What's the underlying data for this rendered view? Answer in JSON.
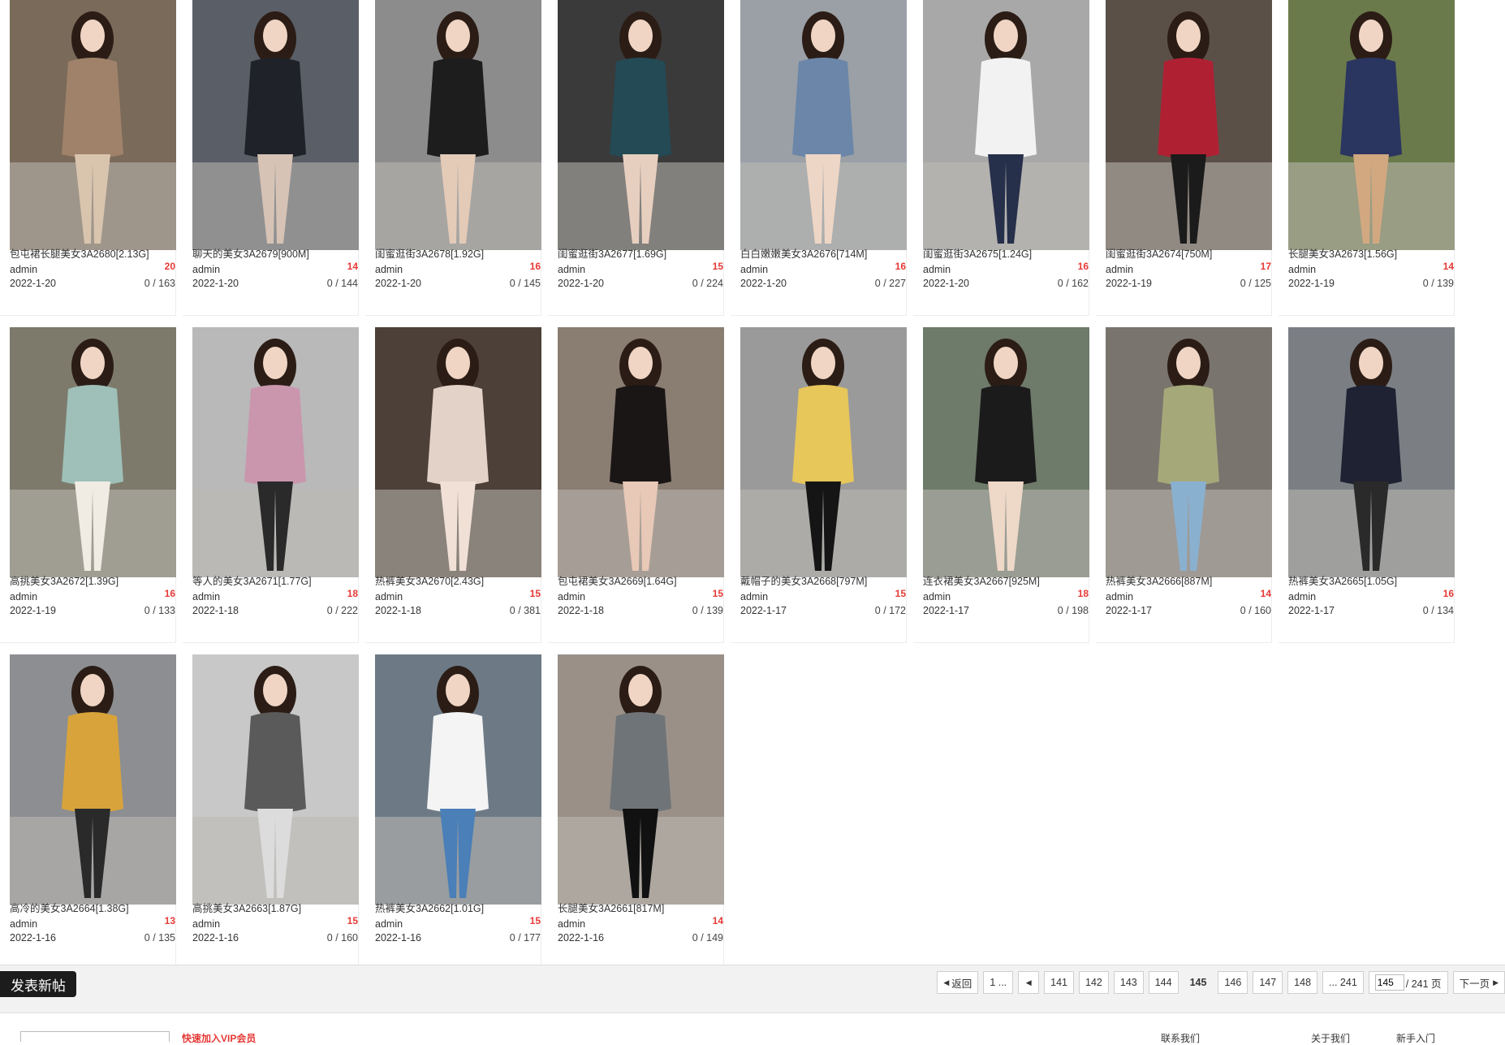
{
  "posts": [
    {
      "title": "包屯裙长腿美女3A2680[2.13G]",
      "author": "admin",
      "date": "2022-1-20",
      "count": "20",
      "stats": "0 / 163",
      "colors": [
        "#7a6a5a",
        "#a0826a",
        "#d9c4ae"
      ]
    },
    {
      "title": "聊天的美女3A2679[900M]",
      "author": "admin",
      "date": "2022-1-20",
      "count": "14",
      "stats": "0 / 144",
      "colors": [
        "#5a5e66",
        "#1f2228",
        "#d6c3b5"
      ]
    },
    {
      "title": "闺蜜逛街3A2678[1.92G]",
      "author": "admin",
      "date": "2022-1-20",
      "count": "16",
      "stats": "0 / 145",
      "colors": [
        "#8c8c8c",
        "#1d1d1d",
        "#e3cbb8"
      ]
    },
    {
      "title": "闺蜜逛街3A2677[1.69G]",
      "author": "admin",
      "date": "2022-1-20",
      "count": "15",
      "stats": "0 / 224",
      "colors": [
        "#3a3a3a",
        "#234a55",
        "#e7cfbf"
      ]
    },
    {
      "title": "白白嫩嫩美女3A2676[714M]",
      "author": "admin",
      "date": "2022-1-20",
      "count": "16",
      "stats": "0 / 227",
      "colors": [
        "#9aa0a6",
        "#6b86a8",
        "#eed6c6"
      ]
    },
    {
      "title": "闺蜜逛街3A2675[1.24G]",
      "author": "admin",
      "date": "2022-1-20",
      "count": "16",
      "stats": "0 / 162",
      "colors": [
        "#a8a8a8",
        "#f2f2f2",
        "#26304a"
      ]
    },
    {
      "title": "闺蜜逛街3A2674[750M]",
      "author": "admin",
      "date": "2022-1-19",
      "count": "17",
      "stats": "0 / 125",
      "colors": [
        "#5b5048",
        "#b02033",
        "#1b1b1b"
      ]
    },
    {
      "title": "长腿美女3A2673[1.56G]",
      "author": "admin",
      "date": "2022-1-19",
      "count": "14",
      "stats": "0 / 139",
      "colors": [
        "#6b7a4a",
        "#2a3560",
        "#d2a880"
      ]
    },
    {
      "title": "高挑美女3A2672[1.39G]",
      "author": "admin",
      "date": "2022-1-19",
      "count": "16",
      "stats": "0 / 133",
      "colors": [
        "#7d7a6c",
        "#9ec0b8",
        "#f0ece4"
      ]
    },
    {
      "title": "等人的美女3A2671[1.77G]",
      "author": "admin",
      "date": "2022-1-18",
      "count": "18",
      "stats": "0 / 222",
      "colors": [
        "#b9b9b9",
        "#c996ad",
        "#2a2a2a"
      ]
    },
    {
      "title": "热裤美女3A2670[2.43G]",
      "author": "admin",
      "date": "2022-1-18",
      "count": "15",
      "stats": "0 / 381",
      "colors": [
        "#4d4038",
        "#e2d2c8",
        "#f1e0d6"
      ]
    },
    {
      "title": "包屯裙美女3A2669[1.64G]",
      "author": "admin",
      "date": "2022-1-18",
      "count": "15",
      "stats": "0 / 139",
      "colors": [
        "#8a7d72",
        "#1a1616",
        "#e8c8b6"
      ]
    },
    {
      "title": "戴帽子的美女3A2668[797M]",
      "author": "admin",
      "date": "2022-1-17",
      "count": "15",
      "stats": "0 / 172",
      "colors": [
        "#9a9a9a",
        "#e7c65a",
        "#151515"
      ]
    },
    {
      "title": "连衣裙美女3A2667[925M]",
      "author": "admin",
      "date": "2022-1-17",
      "count": "18",
      "stats": "0 / 198",
      "colors": [
        "#6e7a6a",
        "#1b1b1b",
        "#eed8c8"
      ]
    },
    {
      "title": "热裤美女3A2666[887M]",
      "author": "admin",
      "date": "2022-1-17",
      "count": "14",
      "stats": "0 / 160",
      "colors": [
        "#7a746e",
        "#a5a97a",
        "#8ab0cf"
      ]
    },
    {
      "title": "热裤美女3A2665[1.05G]",
      "author": "admin",
      "date": "2022-1-17",
      "count": "16",
      "stats": "0 / 134",
      "colors": [
        "#7b7f84",
        "#1f2233",
        "#2a2a2a"
      ]
    },
    {
      "title": "高冷的美女3A2664[1.38G]",
      "author": "admin",
      "date": "2022-1-16",
      "count": "13",
      "stats": "0 / 135",
      "colors": [
        "#8c8e92",
        "#d8a33a",
        "#2a2a2a"
      ]
    },
    {
      "title": "高挑美女3A2663[1.87G]",
      "author": "admin",
      "date": "2022-1-16",
      "count": "15",
      "stats": "0 / 160",
      "colors": [
        "#c8c8c8",
        "#5a5a5a",
        "#dcdcdc"
      ]
    },
    {
      "title": "热裤美女3A2662[1.01G]",
      "author": "admin",
      "date": "2022-1-16",
      "count": "15",
      "stats": "0 / 177",
      "colors": [
        "#6d7a86",
        "#f4f4f4",
        "#4a7fb8"
      ]
    },
    {
      "title": "长腿美女3A2661[817M]",
      "author": "admin",
      "date": "2022-1-16",
      "count": "14",
      "stats": "0 / 149",
      "colors": [
        "#9a9088",
        "#6f7478",
        "#111111"
      ]
    }
  ],
  "bottom_bar": {
    "post_button": "发表新帖",
    "pager": {
      "back": "返回",
      "first": "1 ...",
      "pages": [
        "141",
        "142",
        "143",
        "144",
        "145",
        "146",
        "147",
        "148"
      ],
      "current": "145",
      "last": "... 241",
      "jump_value": "145",
      "total": "/ 241 页",
      "next": "下一页"
    }
  },
  "footer": {
    "note": "快速加入VIP会员",
    "links": [
      "联系我们",
      "关于我们",
      "新手入门"
    ]
  },
  "colors": {
    "accent_red": "#e53935",
    "post_button_bg": "#1c1c1c"
  }
}
